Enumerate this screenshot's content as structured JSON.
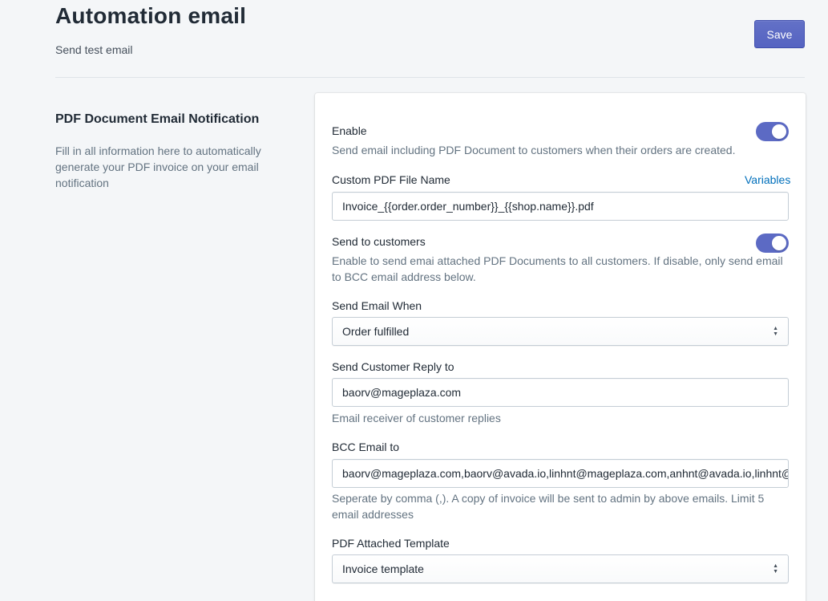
{
  "header": {
    "title": "Automation email",
    "send_test_label": "Send test email",
    "save_label": "Save"
  },
  "section": {
    "title": "PDF Document Email Notification",
    "description": "Fill in all information here to automatically generate your PDF invoice on your email notification"
  },
  "form": {
    "enable": {
      "label": "Enable",
      "help": "Send email including PDF Document to customers when their orders are created.",
      "checked": true
    },
    "file_name": {
      "label": "Custom PDF File Name",
      "variables_link": "Variables",
      "value": "Invoice_{{order.order_number}}_{{shop.name}}.pdf"
    },
    "send_to_customers": {
      "label": "Send to customers",
      "help": "Enable to send emai attached PDF Documents to all customers. If disable, only send email to BCC email address below.",
      "checked": true
    },
    "send_when": {
      "label": "Send Email When",
      "value": "Order fulfilled"
    },
    "reply_to": {
      "label": "Send Customer Reply to",
      "value": "baorv@mageplaza.com",
      "help": "Email receiver of customer replies"
    },
    "bcc": {
      "label": "BCC Email to",
      "value": "baorv@mageplaza.com,baorv@avada.io,linhnt@mageplaza.com,anhnt@avada.io,linhnt@",
      "help": "Seperate by comma (,). A copy of invoice will be sent to admin by above emails. Limit 5 email addresses"
    },
    "template": {
      "label": "PDF Attached Template",
      "value": "Invoice template"
    }
  },
  "colors": {
    "accent": "#5c6ac4",
    "link": "#006fbb",
    "background": "#f4f6f8"
  }
}
